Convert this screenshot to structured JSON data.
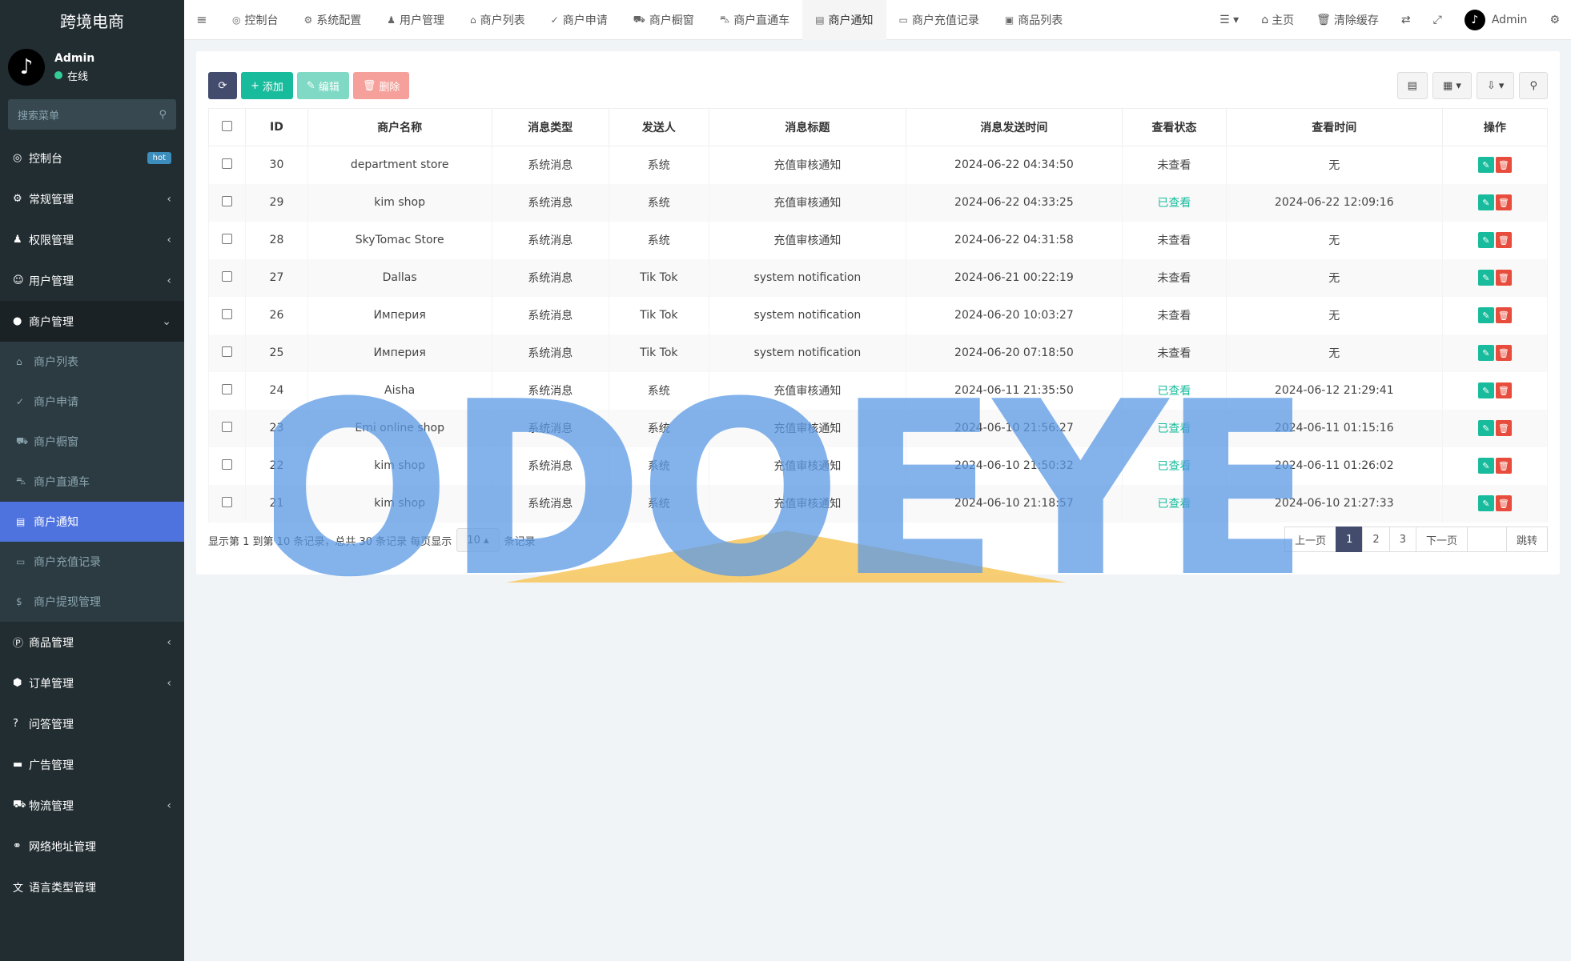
{
  "brand": "跨境电商",
  "user": {
    "name": "Admin",
    "status": "在线"
  },
  "sidebar": {
    "search_placeholder": "搜索菜单",
    "items": [
      {
        "label": "控制台",
        "badge": "hot"
      },
      {
        "label": "常规管理"
      },
      {
        "label": "权限管理"
      },
      {
        "label": "用户管理"
      },
      {
        "label": "商户管理"
      }
    ],
    "submenu": [
      {
        "label": "商户列表"
      },
      {
        "label": "商户申请"
      },
      {
        "label": "商户橱窗"
      },
      {
        "label": "商户直通车"
      },
      {
        "label": "商户通知"
      },
      {
        "label": "商户充值记录"
      },
      {
        "label": "商户提现管理"
      }
    ],
    "items2": [
      {
        "label": "商品管理"
      },
      {
        "label": "订单管理"
      },
      {
        "label": "问答管理"
      },
      {
        "label": "广告管理"
      },
      {
        "label": "物流管理"
      },
      {
        "label": "网络地址管理"
      },
      {
        "label": "语言类型管理"
      }
    ]
  },
  "navbar": {
    "tabs": [
      "控制台",
      "系统配置",
      "用户管理",
      "商户列表",
      "商户申请",
      "商户橱窗",
      "商户直通车",
      "商户通知",
      "商户充值记录",
      "商品列表"
    ],
    "home": "主页",
    "clear_cache": "清除缓存",
    "admin": "Admin"
  },
  "toolbar": {
    "add": "添加",
    "edit": "编辑",
    "delete": "删除"
  },
  "table": {
    "headers": [
      "ID",
      "商户名称",
      "消息类型",
      "发送人",
      "消息标题",
      "消息发送时间",
      "查看状态",
      "查看时间",
      "操作"
    ],
    "rows": [
      {
        "id": "30",
        "name": "department store",
        "type": "系统消息",
        "sender": "系统",
        "title": "充值审核通知",
        "sent": "2024-06-22 04:34:50",
        "status": "未查看",
        "viewed": "无"
      },
      {
        "id": "29",
        "name": "kim shop",
        "type": "系统消息",
        "sender": "系统",
        "title": "充值审核通知",
        "sent": "2024-06-22 04:33:25",
        "status": "已查看",
        "viewed": "2024-06-22 12:09:16"
      },
      {
        "id": "28",
        "name": "SkyTomac Store",
        "type": "系统消息",
        "sender": "系统",
        "title": "充值审核通知",
        "sent": "2024-06-22 04:31:58",
        "status": "未查看",
        "viewed": "无"
      },
      {
        "id": "27",
        "name": "Dallas",
        "type": "系统消息",
        "sender": "Tik Tok",
        "title": "system notification",
        "sent": "2024-06-21 00:22:19",
        "status": "未查看",
        "viewed": "无"
      },
      {
        "id": "26",
        "name": "Империя",
        "type": "系统消息",
        "sender": "Tik Tok",
        "title": "system notification",
        "sent": "2024-06-20 10:03:27",
        "status": "未查看",
        "viewed": "无"
      },
      {
        "id": "25",
        "name": "Империя",
        "type": "系统消息",
        "sender": "Tik Tok",
        "title": "system notification",
        "sent": "2024-06-20 07:18:50",
        "status": "未查看",
        "viewed": "无"
      },
      {
        "id": "24",
        "name": "Aisha",
        "type": "系统消息",
        "sender": "系统",
        "title": "充值审核通知",
        "sent": "2024-06-11 21:35:50",
        "status": "已查看",
        "viewed": "2024-06-12 21:29:41"
      },
      {
        "id": "23",
        "name": "Emi online shop",
        "type": "系统消息",
        "sender": "系统",
        "title": "充值审核通知",
        "sent": "2024-06-10 21:56:27",
        "status": "已查看",
        "viewed": "2024-06-11 01:15:16"
      },
      {
        "id": "22",
        "name": "kim shop",
        "type": "系统消息",
        "sender": "系统",
        "title": "充值审核通知",
        "sent": "2024-06-10 21:50:32",
        "status": "已查看",
        "viewed": "2024-06-11 01:26:02"
      },
      {
        "id": "21",
        "name": "kim shop",
        "type": "系统消息",
        "sender": "系统",
        "title": "充值审核通知",
        "sent": "2024-06-10 21:18:57",
        "status": "已查看",
        "viewed": "2024-06-10 21:27:33"
      }
    ]
  },
  "footer": {
    "summary": "显示第 1 到第 10 条记录，总共 30 条记录 每页显示",
    "page_size": "10",
    "suffix": "条记录",
    "prev": "上一页",
    "pages": [
      "1",
      "2",
      "3"
    ],
    "next": "下一页",
    "jump": "跳转"
  },
  "watermark": {
    "text": "ODOEYE",
    "color": "#5b9ae6",
    "accent": "#f7c55a"
  },
  "colors": {
    "sidebar": "#222d32",
    "active": "#4e73df",
    "success": "#18bc9c",
    "danger": "#e74c3c"
  }
}
